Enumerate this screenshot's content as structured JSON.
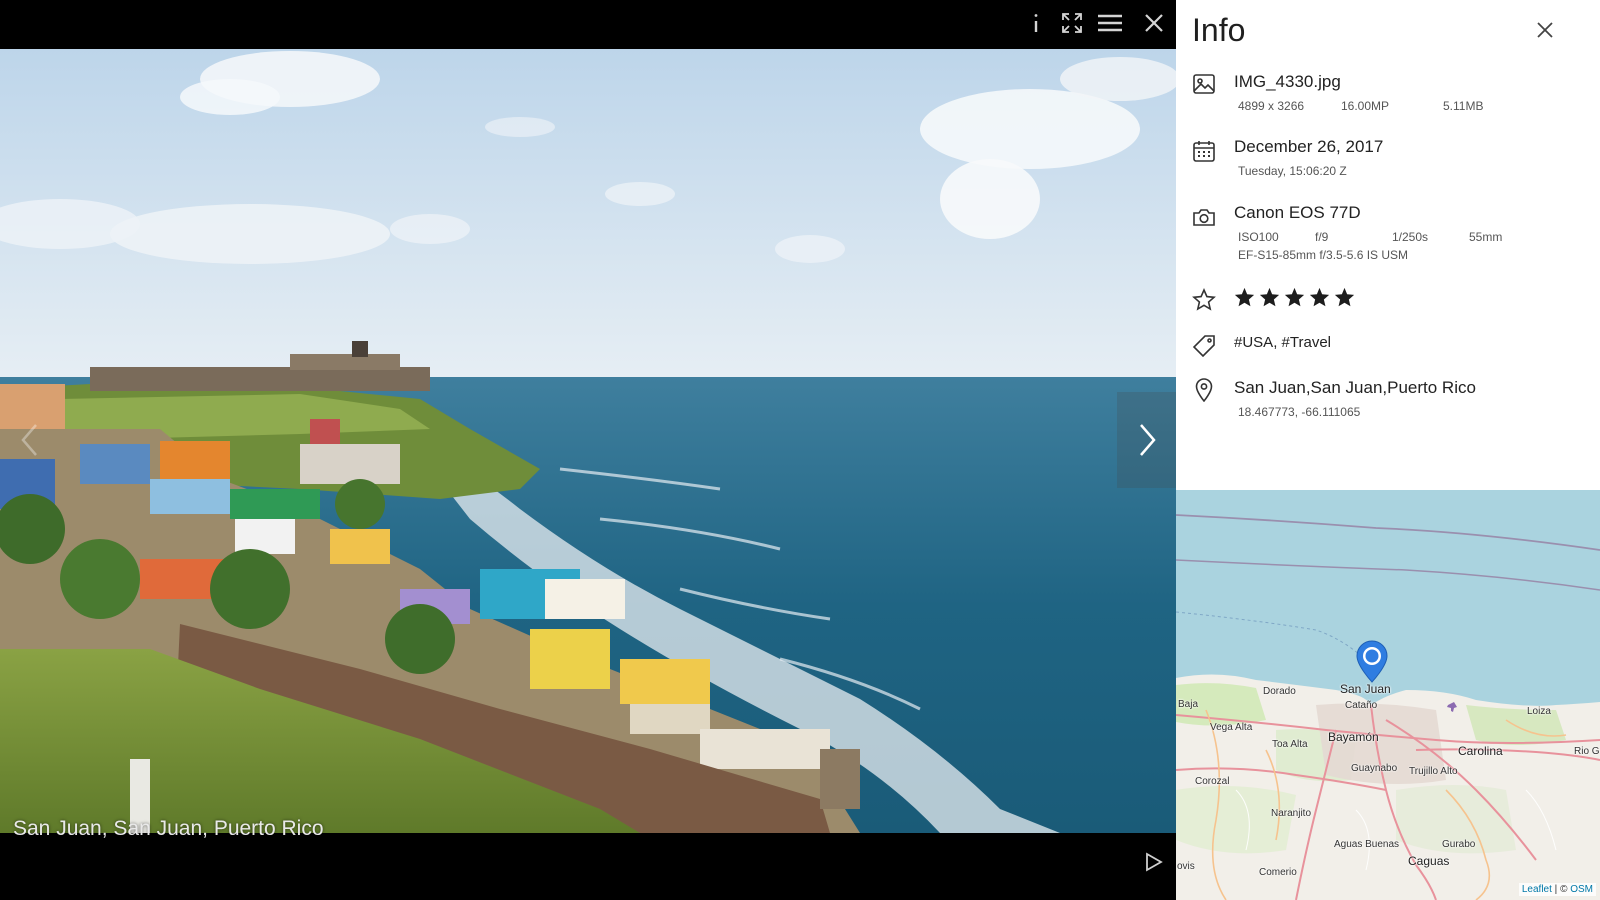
{
  "viewer": {
    "toolbar": {
      "info_icon": "info-icon",
      "fullscreen_icon": "fullscreen-icon",
      "menu_icon": "menu-icon",
      "close_icon": "close-icon"
    },
    "caption": "San Juan, San Juan, Puerto Rico",
    "prev_icon": "chevron-left-icon",
    "next_icon": "chevron-right-icon",
    "play_icon": "play-icon"
  },
  "info": {
    "title": "Info",
    "file": {
      "icon": "image-icon",
      "name": "IMG_4330.jpg",
      "dimensions": "4899 x 3266",
      "megapixels": "16.00MP",
      "size": "5.11MB"
    },
    "date": {
      "icon": "calendar-icon",
      "date": "December 26, 2017",
      "detail": "Tuesday, 15:06:20 Z"
    },
    "camera": {
      "icon": "camera-icon",
      "model": "Canon EOS 77D",
      "iso": "ISO100",
      "aperture": "f/9",
      "shutter": "1/250s",
      "focal": "55mm",
      "lens": "EF-S15-85mm f/3.5-5.6 IS USM"
    },
    "rating": {
      "icon": "star-outline-icon",
      "value": 5,
      "max": 5
    },
    "tags": {
      "icon": "tag-icon",
      "items": [
        "#USA",
        "#Travel"
      ]
    },
    "location": {
      "icon": "location-pin-icon",
      "place": "San Juan,San Juan,Puerto Rico",
      "coords": "18.467773, -66.111065"
    }
  },
  "map": {
    "labels": {
      "san_juan": "San Juan",
      "dorado": "Dorado",
      "catano": "Cataño",
      "baja": "Baja",
      "vega_alta": "Vega Alta",
      "toa_alta": "Toa Alta",
      "bayamon": "Bayamón",
      "carolina": "Carolina",
      "loiza": "Loiza",
      "rio_g": "Rio G",
      "guaynabo": "Guaynabo",
      "trujillo_alto": "Trujillo Alto",
      "corozal": "Corozal",
      "naranjito": "Naranjito",
      "aguas_buenas": "Aguas Buenas",
      "gurabo": "Gurabo",
      "caguas": "Caguas",
      "comerio": "Comerio",
      "ovis": "ovis"
    },
    "attribution": {
      "leaflet": "Leaflet",
      "separator": "|",
      "copyright": "©",
      "osm": "OSM"
    },
    "colors": {
      "water": "#aad3df",
      "land": "#f2efe9",
      "road": "#e8929c",
      "marker": "#2f7de1"
    }
  }
}
